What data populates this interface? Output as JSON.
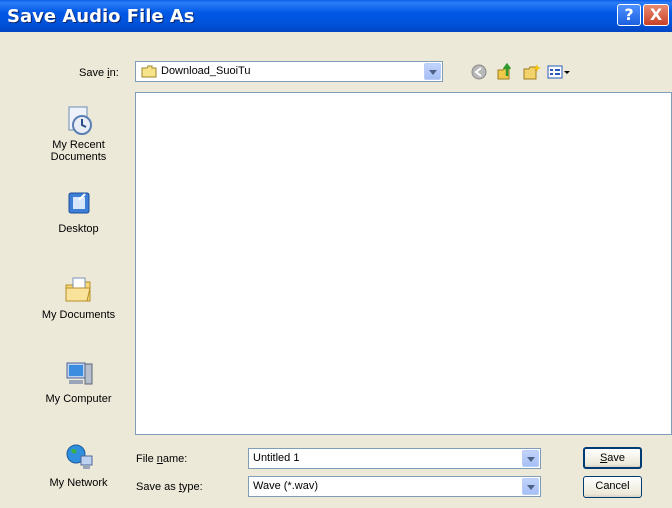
{
  "window": {
    "title": "Save Audio File As",
    "help_glyph": "?",
    "close_glyph": "X"
  },
  "header": {
    "save_in_label_pre": "Save ",
    "save_in_label_key": "i",
    "save_in_label_post": "n:",
    "current_folder": "Download_SuoiTu"
  },
  "places": [
    {
      "label_line1": "My Recent",
      "label_line2": "Documents",
      "icon": "recent-documents-icon"
    },
    {
      "label_line1": "Desktop",
      "icon": "desktop-icon"
    },
    {
      "label_line1": "My Documents",
      "icon": "my-documents-icon"
    },
    {
      "label_line1": "My Computer",
      "icon": "my-computer-icon"
    },
    {
      "label_line1": "My Network",
      "icon": "my-network-icon"
    }
  ],
  "filename": {
    "label_pre": "File ",
    "label_key": "n",
    "label_post": "ame:",
    "value": "Untitled 1"
  },
  "filetype": {
    "label_pre": "Save as ",
    "label_key": "t",
    "label_post": "ype:",
    "value": "Wave (*.wav)"
  },
  "buttons": {
    "save_key": "S",
    "save_rest": "ave",
    "cancel": "Cancel"
  },
  "colors": {
    "title_bar": "#0058e6",
    "dialog_bg": "#ece9d8",
    "border": "#7f9db9"
  }
}
